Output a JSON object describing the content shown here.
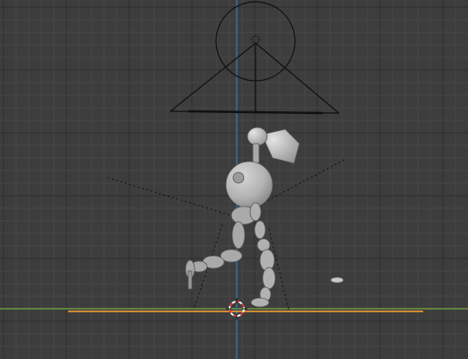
{
  "viewport": {
    "mode": "3D viewport",
    "colors": {
      "background": "#3d3d3d",
      "grid_minor": "#464646",
      "grid_major": "#2f2f2f",
      "x_axis": "#6f9a3f",
      "y_axis": "#3f6f96",
      "ground_line": "#d08a3a",
      "model": "#b4b4b4",
      "model_shadow": "#858585",
      "light_lines": "#111111",
      "cursor_red": "#d83a3a",
      "cursor_white": "#f2f2f2"
    },
    "objects": [
      {
        "name": "light-cone",
        "icon": "spot-light-icon"
      },
      {
        "name": "figure",
        "icon": "armature-figure-icon"
      },
      {
        "name": "small-object",
        "icon": "empty-icon"
      }
    ]
  }
}
